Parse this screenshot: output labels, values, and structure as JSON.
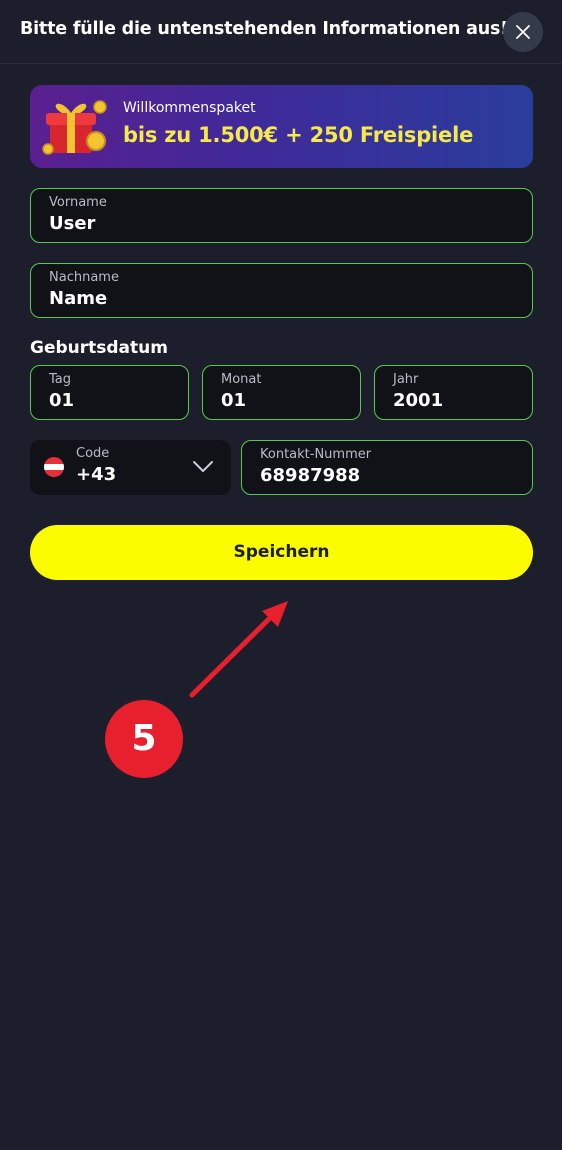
{
  "header": {
    "title": "Bitte fülle die untenstehenden Informationen aus!",
    "close_icon": "close-icon"
  },
  "banner": {
    "label": "Willkommenspaket",
    "offer": "bis zu 1.500€ + 250 Freispiele",
    "icon": "gift-coins-icon"
  },
  "form": {
    "first_name": {
      "label": "Vorname",
      "value": "User"
    },
    "last_name": {
      "label": "Nachname",
      "value": "Name"
    },
    "birthdate": {
      "title": "Geburtsdatum",
      "day": {
        "label": "Tag",
        "value": "01"
      },
      "month": {
        "label": "Monat",
        "value": "01"
      },
      "year": {
        "label": "Jahr",
        "value": "2001"
      }
    },
    "phone_code": {
      "label": "Code",
      "value": "+43",
      "flag_icon": "austria-flag-icon"
    },
    "phone_number": {
      "label": "Kontakt-Nummer",
      "value": "68987988"
    },
    "save_label": "Speichern"
  },
  "annotation": {
    "step": "5"
  },
  "colors": {
    "background": "#1c1f2b",
    "field_border": "#57c84d",
    "button": "#fcfc00",
    "annotation": "#e81f2c",
    "offer_text": "#f6e94a"
  }
}
